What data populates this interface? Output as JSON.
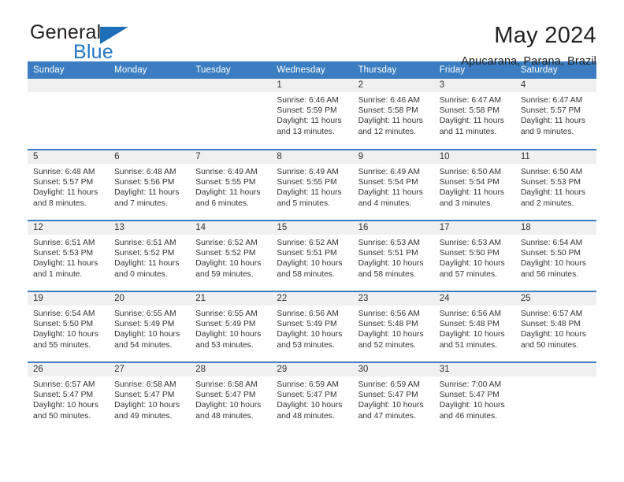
{
  "logo": {
    "line1": "General",
    "line2": "Blue",
    "triangle_icon": "triangle-icon",
    "blue": "#2275c4"
  },
  "header": {
    "title": "May 2024",
    "subtitle": "Apucarana, Parana, Brazil"
  },
  "theme": {
    "header_blue": "#3b7dc0",
    "band_gray": "#f0f0f0",
    "text": "#333333"
  },
  "weekday_headers": [
    "Sunday",
    "Monday",
    "Tuesday",
    "Wednesday",
    "Thursday",
    "Friday",
    "Saturday"
  ],
  "weeks": [
    [
      {
        "day": "",
        "sunrise": "",
        "sunset": "",
        "daylight": ""
      },
      {
        "day": "",
        "sunrise": "",
        "sunset": "",
        "daylight": ""
      },
      {
        "day": "",
        "sunrise": "",
        "sunset": "",
        "daylight": ""
      },
      {
        "day": "1",
        "sunrise": "Sunrise: 6:46 AM",
        "sunset": "Sunset: 5:59 PM",
        "daylight": "Daylight: 11 hours and 13 minutes."
      },
      {
        "day": "2",
        "sunrise": "Sunrise: 6:46 AM",
        "sunset": "Sunset: 5:58 PM",
        "daylight": "Daylight: 11 hours and 12 minutes."
      },
      {
        "day": "3",
        "sunrise": "Sunrise: 6:47 AM",
        "sunset": "Sunset: 5:58 PM",
        "daylight": "Daylight: 11 hours and 11 minutes."
      },
      {
        "day": "4",
        "sunrise": "Sunrise: 6:47 AM",
        "sunset": "Sunset: 5:57 PM",
        "daylight": "Daylight: 11 hours and 9 minutes."
      }
    ],
    [
      {
        "day": "5",
        "sunrise": "Sunrise: 6:48 AM",
        "sunset": "Sunset: 5:57 PM",
        "daylight": "Daylight: 11 hours and 8 minutes."
      },
      {
        "day": "6",
        "sunrise": "Sunrise: 6:48 AM",
        "sunset": "Sunset: 5:56 PM",
        "daylight": "Daylight: 11 hours and 7 minutes."
      },
      {
        "day": "7",
        "sunrise": "Sunrise: 6:49 AM",
        "sunset": "Sunset: 5:55 PM",
        "daylight": "Daylight: 11 hours and 6 minutes."
      },
      {
        "day": "8",
        "sunrise": "Sunrise: 6:49 AM",
        "sunset": "Sunset: 5:55 PM",
        "daylight": "Daylight: 11 hours and 5 minutes."
      },
      {
        "day": "9",
        "sunrise": "Sunrise: 6:49 AM",
        "sunset": "Sunset: 5:54 PM",
        "daylight": "Daylight: 11 hours and 4 minutes."
      },
      {
        "day": "10",
        "sunrise": "Sunrise: 6:50 AM",
        "sunset": "Sunset: 5:54 PM",
        "daylight": "Daylight: 11 hours and 3 minutes."
      },
      {
        "day": "11",
        "sunrise": "Sunrise: 6:50 AM",
        "sunset": "Sunset: 5:53 PM",
        "daylight": "Daylight: 11 hours and 2 minutes."
      }
    ],
    [
      {
        "day": "12",
        "sunrise": "Sunrise: 6:51 AM",
        "sunset": "Sunset: 5:53 PM",
        "daylight": "Daylight: 11 hours and 1 minute."
      },
      {
        "day": "13",
        "sunrise": "Sunrise: 6:51 AM",
        "sunset": "Sunset: 5:52 PM",
        "daylight": "Daylight: 11 hours and 0 minutes."
      },
      {
        "day": "14",
        "sunrise": "Sunrise: 6:52 AM",
        "sunset": "Sunset: 5:52 PM",
        "daylight": "Daylight: 10 hours and 59 minutes."
      },
      {
        "day": "15",
        "sunrise": "Sunrise: 6:52 AM",
        "sunset": "Sunset: 5:51 PM",
        "daylight": "Daylight: 10 hours and 58 minutes."
      },
      {
        "day": "16",
        "sunrise": "Sunrise: 6:53 AM",
        "sunset": "Sunset: 5:51 PM",
        "daylight": "Daylight: 10 hours and 58 minutes."
      },
      {
        "day": "17",
        "sunrise": "Sunrise: 6:53 AM",
        "sunset": "Sunset: 5:50 PM",
        "daylight": "Daylight: 10 hours and 57 minutes."
      },
      {
        "day": "18",
        "sunrise": "Sunrise: 6:54 AM",
        "sunset": "Sunset: 5:50 PM",
        "daylight": "Daylight: 10 hours and 56 minutes."
      }
    ],
    [
      {
        "day": "19",
        "sunrise": "Sunrise: 6:54 AM",
        "sunset": "Sunset: 5:50 PM",
        "daylight": "Daylight: 10 hours and 55 minutes."
      },
      {
        "day": "20",
        "sunrise": "Sunrise: 6:55 AM",
        "sunset": "Sunset: 5:49 PM",
        "daylight": "Daylight: 10 hours and 54 minutes."
      },
      {
        "day": "21",
        "sunrise": "Sunrise: 6:55 AM",
        "sunset": "Sunset: 5:49 PM",
        "daylight": "Daylight: 10 hours and 53 minutes."
      },
      {
        "day": "22",
        "sunrise": "Sunrise: 6:56 AM",
        "sunset": "Sunset: 5:49 PM",
        "daylight": "Daylight: 10 hours and 53 minutes."
      },
      {
        "day": "23",
        "sunrise": "Sunrise: 6:56 AM",
        "sunset": "Sunset: 5:48 PM",
        "daylight": "Daylight: 10 hours and 52 minutes."
      },
      {
        "day": "24",
        "sunrise": "Sunrise: 6:56 AM",
        "sunset": "Sunset: 5:48 PM",
        "daylight": "Daylight: 10 hours and 51 minutes."
      },
      {
        "day": "25",
        "sunrise": "Sunrise: 6:57 AM",
        "sunset": "Sunset: 5:48 PM",
        "daylight": "Daylight: 10 hours and 50 minutes."
      }
    ],
    [
      {
        "day": "26",
        "sunrise": "Sunrise: 6:57 AM",
        "sunset": "Sunset: 5:47 PM",
        "daylight": "Daylight: 10 hours and 50 minutes."
      },
      {
        "day": "27",
        "sunrise": "Sunrise: 6:58 AM",
        "sunset": "Sunset: 5:47 PM",
        "daylight": "Daylight: 10 hours and 49 minutes."
      },
      {
        "day": "28",
        "sunrise": "Sunrise: 6:58 AM",
        "sunset": "Sunset: 5:47 PM",
        "daylight": "Daylight: 10 hours and 48 minutes."
      },
      {
        "day": "29",
        "sunrise": "Sunrise: 6:59 AM",
        "sunset": "Sunset: 5:47 PM",
        "daylight": "Daylight: 10 hours and 48 minutes."
      },
      {
        "day": "30",
        "sunrise": "Sunrise: 6:59 AM",
        "sunset": "Sunset: 5:47 PM",
        "daylight": "Daylight: 10 hours and 47 minutes."
      },
      {
        "day": "31",
        "sunrise": "Sunrise: 7:00 AM",
        "sunset": "Sunset: 5:47 PM",
        "daylight": "Daylight: 10 hours and 46 minutes."
      },
      {
        "day": "",
        "sunrise": "",
        "sunset": "",
        "daylight": ""
      }
    ]
  ]
}
